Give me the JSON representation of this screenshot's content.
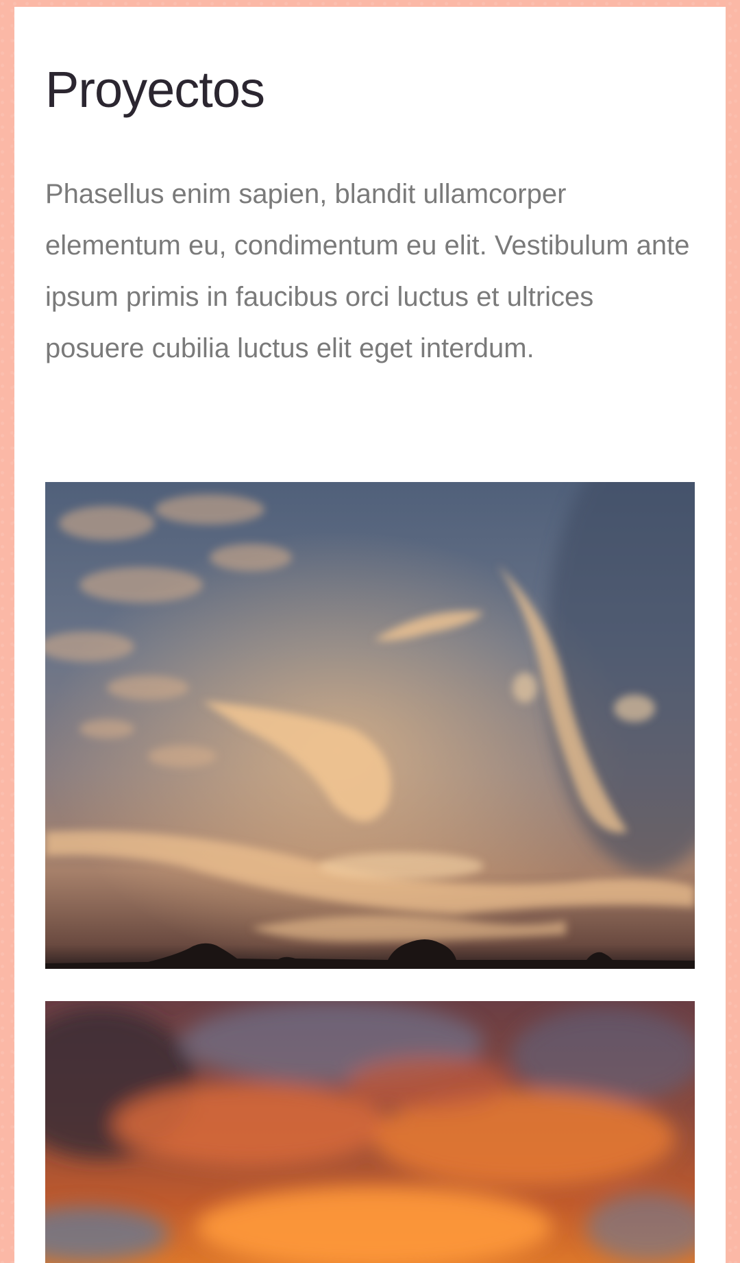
{
  "header": {
    "title": "Proyectos"
  },
  "intro": {
    "text": "Phasellus enim sapien, blandit ullamcorper elementum eu, condimentum eu elit. Vestibulum ante ipsum primis in faucibus orci luctus et ultrices posuere cubilia luctus elit eget interdum."
  },
  "colors": {
    "background": "#fbb8a6",
    "card": "#ffffff",
    "title": "#2b2630",
    "body_text": "#7a7a7a"
  }
}
